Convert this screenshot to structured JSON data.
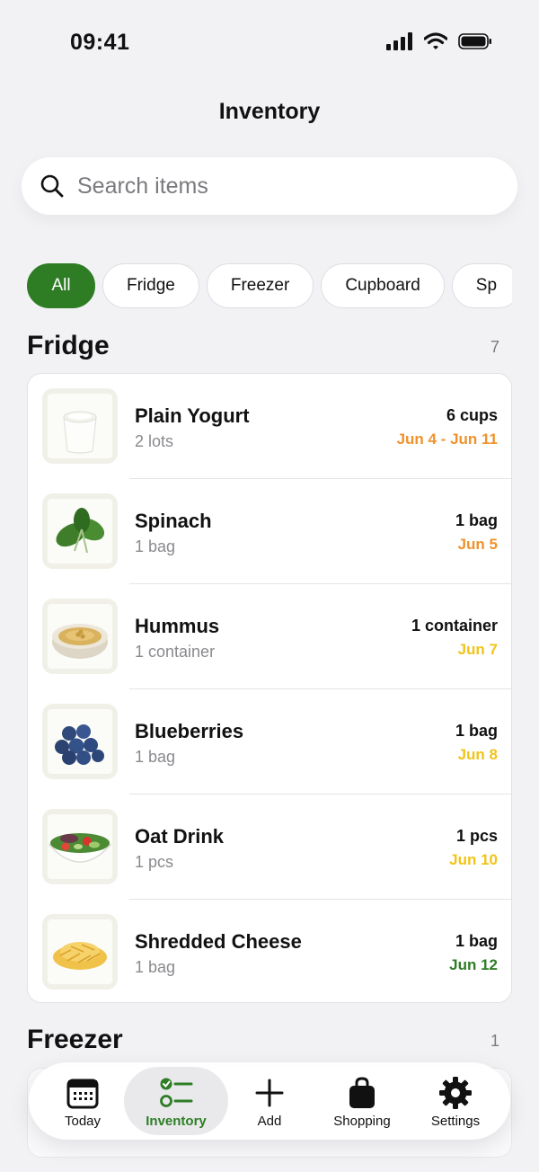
{
  "status": {
    "time": "09:41"
  },
  "nav": {
    "title": "Inventory"
  },
  "search": {
    "placeholder": "Search items"
  },
  "filters": [
    {
      "label": "All",
      "active": true
    },
    {
      "label": "Fridge",
      "active": false
    },
    {
      "label": "Freezer",
      "active": false
    },
    {
      "label": "Cupboard",
      "active": false
    },
    {
      "label": "Sp",
      "active": false
    }
  ],
  "sections": [
    {
      "title": "Fridge",
      "count": "7",
      "items": [
        {
          "name": "Plain Yogurt",
          "sub": "2 lots",
          "qty": "6 cups",
          "date": "Jun 4 - Jun 11",
          "date_color": "#f0922b",
          "icon": "yogurt-icon"
        },
        {
          "name": "Spinach",
          "sub": "1 bag",
          "qty": "1 bag",
          "date": "Jun 5",
          "date_color": "#f0922b",
          "icon": "spinach-icon"
        },
        {
          "name": "Hummus",
          "sub": "1 container",
          "qty": "1 container",
          "date": "Jun 7",
          "date_color": "#f2c318",
          "icon": "hummus-icon"
        },
        {
          "name": "Blueberries",
          "sub": "1 bag",
          "qty": "1 bag",
          "date": "Jun 8",
          "date_color": "#f2c318",
          "icon": "blueberries-icon"
        },
        {
          "name": "Oat Drink",
          "sub": "1 pcs",
          "qty": "1 pcs",
          "date": "Jun 10",
          "date_color": "#f2c318",
          "icon": "salad-icon"
        },
        {
          "name": "Shredded Cheese",
          "sub": "1 bag",
          "qty": "1 bag",
          "date": "Jun 12",
          "date_color": "#2e7d25",
          "icon": "cheese-icon"
        }
      ]
    },
    {
      "title": "Freezer",
      "count": "1"
    }
  ],
  "tabs": [
    {
      "label": "Today",
      "icon": "calendar-icon"
    },
    {
      "label": "Inventory",
      "icon": "checklist-icon",
      "active": true
    },
    {
      "label": "Add",
      "icon": "plus-icon"
    },
    {
      "label": "Shopping",
      "icon": "bag-icon"
    },
    {
      "label": "Settings",
      "icon": "gear-icon"
    }
  ],
  "colors": {
    "accent": "#2e7d25",
    "background": "#f2f2f5"
  }
}
